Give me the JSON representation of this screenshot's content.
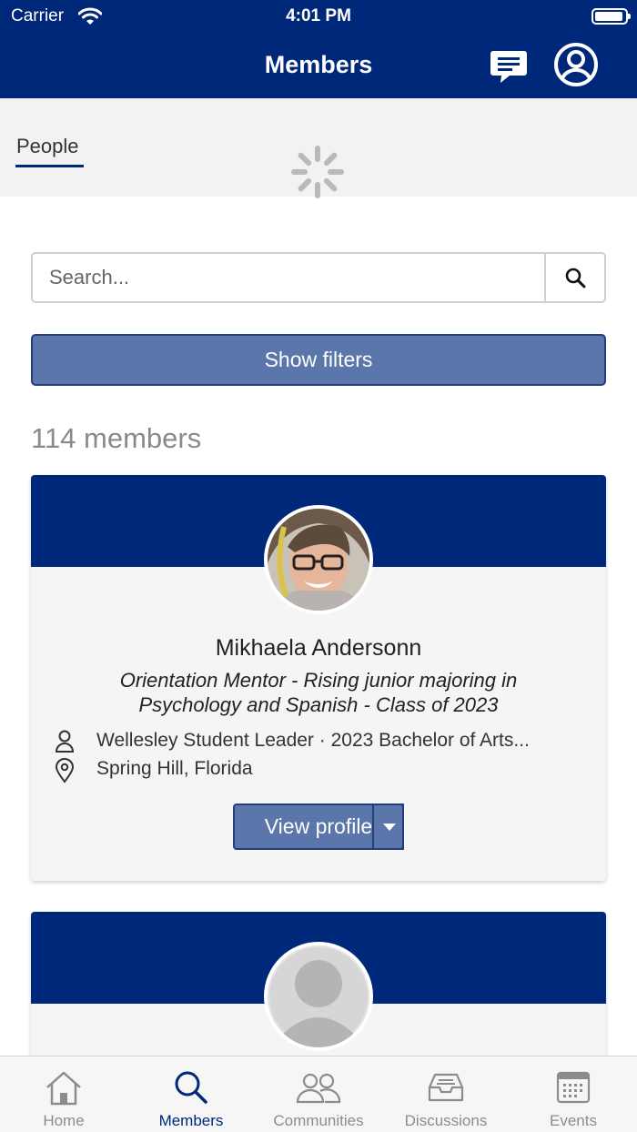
{
  "status_bar": {
    "carrier": "Carrier",
    "time": "4:01 PM",
    "battery_level": 0.95
  },
  "nav": {
    "title": "Members",
    "chat_icon": "chat-bubble-icon",
    "account_icon": "user-circle-icon"
  },
  "tabs": [
    {
      "label": "People",
      "selected": true
    }
  ],
  "loading": true,
  "search": {
    "placeholder": "Search...",
    "value": ""
  },
  "filters": {
    "label": "Show filters"
  },
  "member_count": "114 members",
  "members": [
    {
      "name": "Mikhaela Andersonn",
      "headline": "Orientation Mentor - Rising junior majoring in Psychology and Spanish - Class of 2023",
      "affiliation": "Wellesley Student Leader · 2023 Bachelor of Arts...",
      "location": "Spring Hill, Florida",
      "view_profile_label": "View profile"
    },
    {
      "name": "",
      "headline": "",
      "affiliation": "",
      "location": "",
      "view_profile_label": ""
    }
  ],
  "bottom_tabs": [
    {
      "label": "Home",
      "icon": "home-icon",
      "active": false
    },
    {
      "label": "Members",
      "icon": "search-icon",
      "active": true
    },
    {
      "label": "Communities",
      "icon": "people-icon",
      "active": false
    },
    {
      "label": "Discussions",
      "icon": "inbox-icon",
      "active": false
    },
    {
      "label": "Events",
      "icon": "calendar-icon",
      "active": false
    }
  ],
  "colors": {
    "brand": "#00287a",
    "button": "#5b76ab",
    "button_border": "#233e7a",
    "muted": "#8a8a8a"
  }
}
